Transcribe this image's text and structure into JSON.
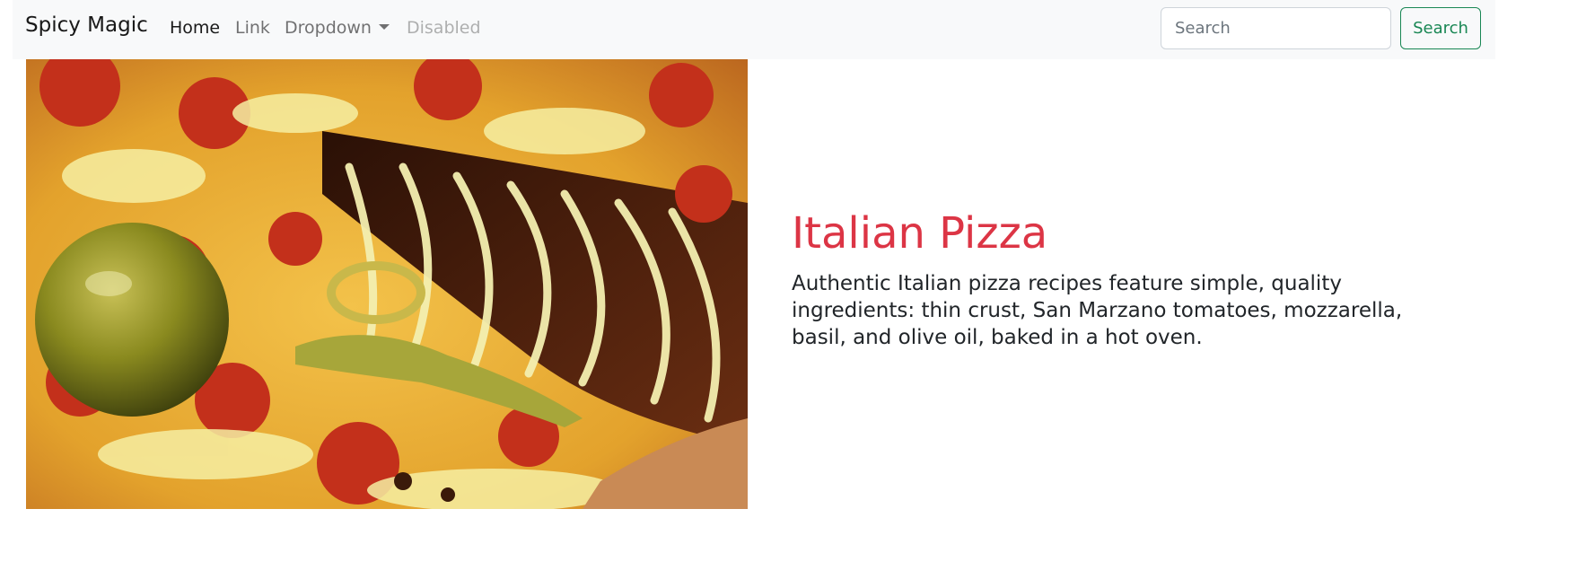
{
  "navbar": {
    "brand": "Spicy Magic",
    "links": [
      {
        "label": "Home",
        "state": "active"
      },
      {
        "label": "Link",
        "state": "normal"
      },
      {
        "label": "Dropdown",
        "state": "normal"
      },
      {
        "label": "Disabled",
        "state": "disabled"
      }
    ],
    "search": {
      "placeholder": "Search",
      "value": "",
      "button_label": "Search"
    }
  },
  "hero": {
    "image_alt": "Italian Pizza",
    "title": "Italian Pizza",
    "description": "Authentic Italian pizza recipes feature simple, quality ingredients: thin crust, San Marzano tomatoes, mozzarella, basil, and olive oil, baked in a hot oven."
  },
  "colors": {
    "navbar_bg": "#f8f9fa",
    "title": "#dc3545",
    "search_button": "#198754"
  }
}
